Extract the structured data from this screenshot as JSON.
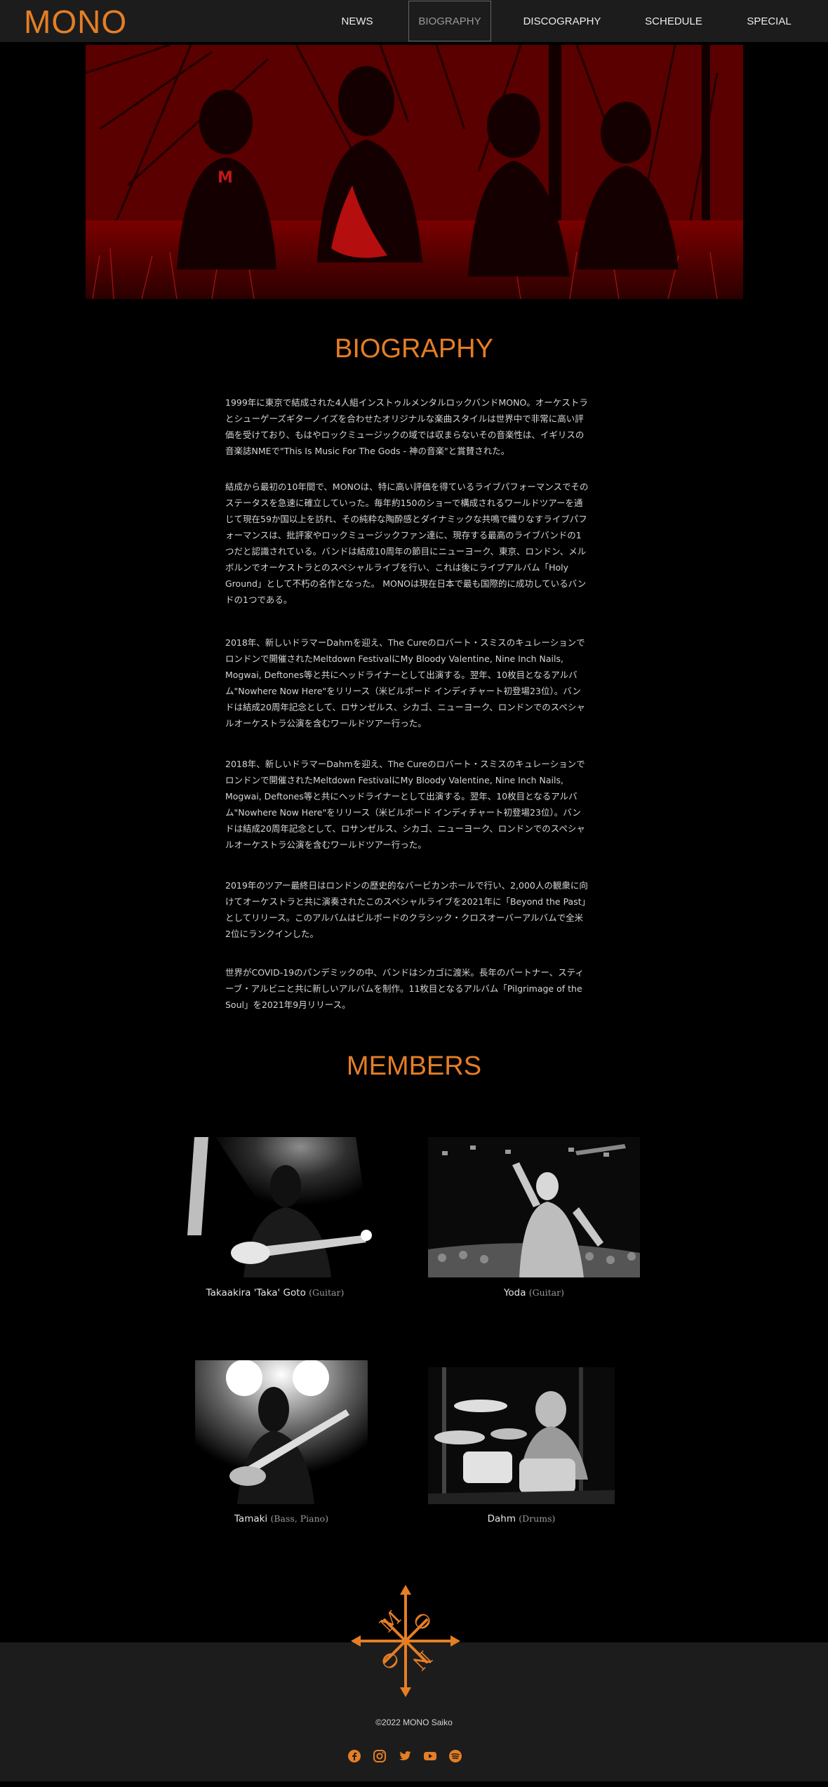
{
  "brand": {
    "logo": "MONO",
    "accent": "#e57e25",
    "header_bg": "#1c1c1c"
  },
  "nav": {
    "items": [
      {
        "label": "NEWS",
        "active": false
      },
      {
        "label": "BIOGRAPHY",
        "active": true
      },
      {
        "label": "DISCOGRAPHY",
        "active": false
      },
      {
        "label": "SCHEDULE",
        "active": false
      },
      {
        "label": "SPECIAL",
        "active": false
      }
    ]
  },
  "hero": {
    "alt": "band photo"
  },
  "biography": {
    "title": "BIOGRAPHY",
    "paragraphs": [
      "1999年に東京で結成された4人組インストゥルメンタルロックバンドMONO。オーケストラとシューゲーズギターノイズを合わせたオリジナルな楽曲スタイルは世界中で非常に高い評価を受けており、もはやロックミュージックの域では収まらないその音楽性は、イギリスの音楽誌NMEで\"This Is Music For The Gods - 神の音楽\"と賞賛された。",
      "結成から最初の10年間で、MONOは、特に高い評価を得ているライブパフォーマンスでそのステータスを急速に確立していった。毎年約150のショーで構成されるワールドツアーを通じて現在59か国以上を訪れ、その純粋な陶酔感とダイナミックな共鳴で織りなすライブパフォーマンスは、批評家やロックミュージックファン達に、現存する最高のライブバンドの1つだと認識されている。バンドは結成10周年の節目にニューヨーク、東京、ロンドン、メルボルンでオーケストラとのスペシャルライブを行い、これは後にライブアルバム「Holy Ground」として不朽の名作となった。 MONOは現在日本で最も国際的に成功しているバンドの1つである。",
      "2018年、新しいドラマーDahmを迎え、The Cureのロバート・スミスのキュレーションでロンドンで開催されたMeltdown FestivalにMy Bloody Valentine, Nine Inch Nails, Mogwai, Deftones等と共にヘッドライナーとして出演する。翌年、10枚目となるアルバム\"Nowhere Now Here\"をリリース（米ビルボード インディチャート初登場23位）。バンドは結成20周年記念として、ロサンゼルス、シカゴ、ニューヨーク、ロンドンでのスペシャルオーケストラ公演を含むワールドツアー行った。",
      "2018年、新しいドラマーDahmを迎え、The Cureのロバート・スミスのキュレーションでロンドンで開催されたMeltdown FestivalにMy Bloody Valentine, Nine Inch Nails, Mogwai, Deftones等と共にヘッドライナーとして出演する。翌年、10枚目となるアルバム\"Nowhere Now Here\"をリリース（米ビルボード インディチャート初登場23位）。バンドは結成20周年記念として、ロサンゼルス、シカゴ、ニューヨーク、ロンドンでのスペシャルオーケストラ公演を含むワールドツアー行った。",
      "2019年のツアー最終日はロンドンの歴史的なバービカンホールで行い、2,000人の観衆に向けてオーケストラと共に演奏されたこのスペシャルライブを2021年に「Beyond the Past」としてリリース。このアルバムはビルボードのクラシック・クロスオーバーアルバムで全米2位にランクインした。",
      "世界がCOVID-19のパンデミックの中、バンドはシカゴに渡米。長年のパートナー、スティーブ・アルビニと共に新しいアルバムを制作。11枚目となるアルバム「Pilgrimage of the Soul」を2021年9月リリース。"
    ]
  },
  "members": {
    "title": "MEMBERS",
    "list": [
      {
        "name": "Takaakira 'Taka' Goto",
        "role": "(Guitar)"
      },
      {
        "name": "Yoda",
        "role": "(Guitar)"
      },
      {
        "name": "Tamaki",
        "role": "(Bass, Piano)"
      },
      {
        "name": "Dahm",
        "role": "(Drums)"
      }
    ]
  },
  "footer": {
    "emblem_letters": [
      "M",
      "O",
      "N",
      "O"
    ],
    "copyright": "©2022 MONO Saiko",
    "social": [
      "facebook-icon",
      "instagram-icon",
      "twitter-icon",
      "youtube-icon",
      "spotify-icon"
    ]
  }
}
